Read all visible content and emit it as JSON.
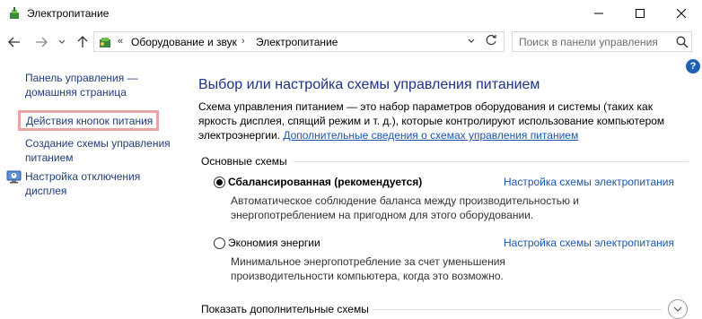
{
  "window": {
    "title": "Электропитание",
    "minimize_glyph": "—",
    "maximize_glyph": "☐",
    "close_glyph": "✕"
  },
  "nav": {
    "breadcrumb_prefix": "«",
    "breadcrumbs": [
      "Оборудование и звук",
      "Электропитание"
    ],
    "breadcrumb_sep": "›",
    "search_placeholder": "Поиск в панели управления"
  },
  "help": {
    "glyph": "?"
  },
  "sidebar": {
    "home": "Панель управления — домашняя страница",
    "items": [
      {
        "label": "Действия кнопок питания",
        "highlighted": true
      },
      {
        "label": "Создание схемы управления питанием"
      },
      {
        "label": "Настройка отключения дисплея",
        "icon": "power-settings-icon"
      }
    ]
  },
  "main": {
    "title": "Выбор или настройка схемы управления питанием",
    "description": "Схема управления питанием — это набор параметров оборудования и системы (таких как яркость дисплея, спящий режим и т. д.), которые контролируют использование компьютером электроэнергии.",
    "more_link": "Дополнительные сведения о схемах управления питанием",
    "group_label": "Основные схемы",
    "plans": [
      {
        "name": "Сбалансированная (рекомендуется)",
        "selected": true,
        "link": "Настройка схемы электропитания",
        "description": "Автоматическое соблюдение баланса между производительностью и энергопотреблением на пригодном для этого оборудовании."
      },
      {
        "name": "Экономия энергии",
        "selected": false,
        "link": "Настройка схемы электропитания",
        "description": "Минимальное энергопотребление за счет уменьшения производительности компьютера, когда это возможно."
      }
    ],
    "show_more": "Показать дополнительные схемы"
  },
  "colors": {
    "link": "#1a55b0",
    "title": "#1e3287",
    "highlight_border": "#e8a5a5"
  }
}
